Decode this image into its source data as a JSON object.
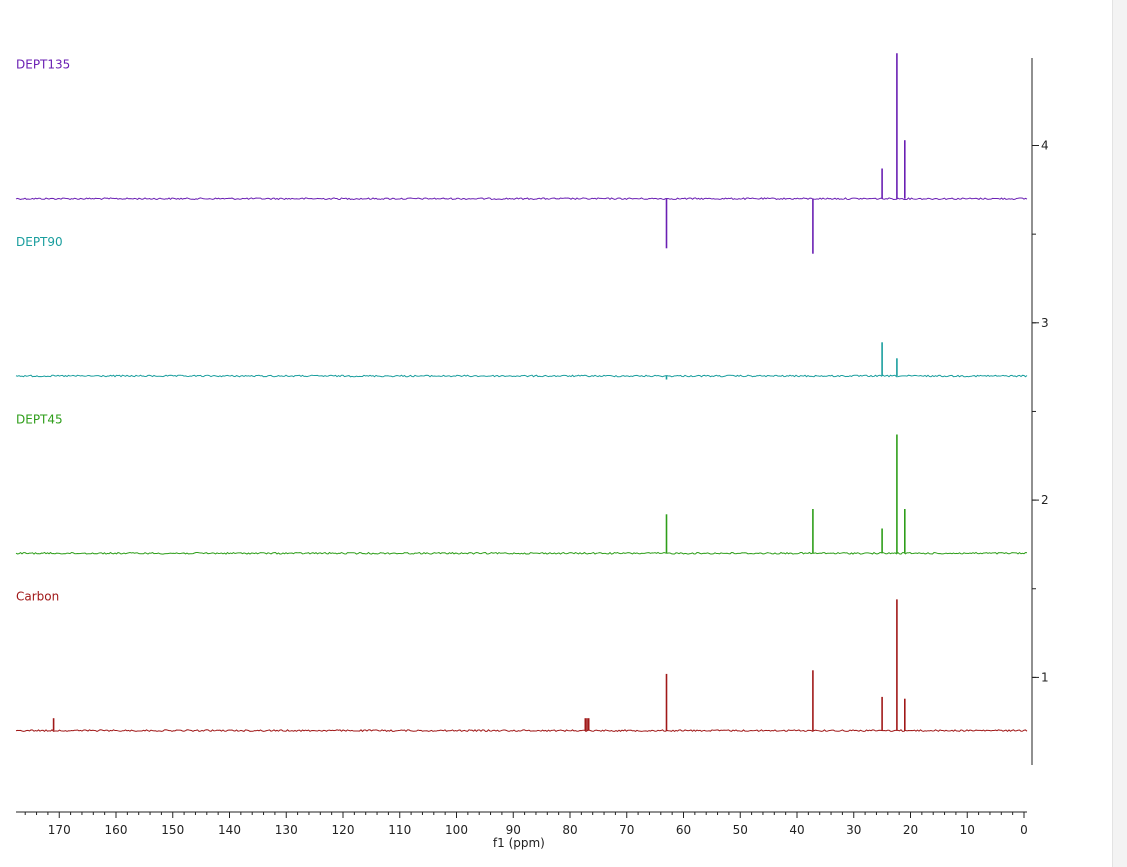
{
  "chart_data": {
    "type": "line",
    "xlabel": "f1 (ppm)",
    "xlim": [
      178,
      0
    ],
    "x_ticks": [
      170,
      160,
      150,
      140,
      130,
      120,
      110,
      100,
      90,
      80,
      70,
      60,
      50,
      40,
      30,
      20,
      10,
      0
    ],
    "ylim": [
      0.3,
      4.5
    ],
    "y_ticks": [
      1,
      2,
      3,
      4
    ],
    "series": [
      {
        "name": "DEPT135",
        "color": "#6a1fb3",
        "baseline": 3.7,
        "peaks": [
          {
            "x": 63.0,
            "y": 3.42
          },
          {
            "x": 37.2,
            "y": 3.39
          },
          {
            "x": 25.0,
            "y": 3.87
          },
          {
            "x": 22.4,
            "y": 4.52
          },
          {
            "x": 21.0,
            "y": 4.03
          }
        ]
      },
      {
        "name": "DEPT90",
        "color": "#1a9e9e",
        "baseline": 2.7,
        "peaks": [
          {
            "x": 63.0,
            "y": 2.68
          },
          {
            "x": 25.0,
            "y": 2.89
          },
          {
            "x": 22.4,
            "y": 2.8
          }
        ]
      },
      {
        "name": "DEPT45",
        "color": "#2e9e1a",
        "baseline": 1.7,
        "peaks": [
          {
            "x": 63.0,
            "y": 1.92
          },
          {
            "x": 37.2,
            "y": 1.95
          },
          {
            "x": 25.0,
            "y": 1.84
          },
          {
            "x": 22.4,
            "y": 2.37
          },
          {
            "x": 21.0,
            "y": 1.95
          }
        ]
      },
      {
        "name": "Carbon",
        "color": "#a01818",
        "baseline": 0.7,
        "peaks": [
          {
            "x": 171.0,
            "y": 0.77
          },
          {
            "x": 77.3,
            "y": 0.77
          },
          {
            "x": 77.0,
            "y": 0.77
          },
          {
            "x": 76.7,
            "y": 0.77
          },
          {
            "x": 63.0,
            "y": 1.02
          },
          {
            "x": 37.2,
            "y": 1.04
          },
          {
            "x": 25.0,
            "y": 0.89
          },
          {
            "x": 22.4,
            "y": 1.44
          },
          {
            "x": 21.0,
            "y": 0.88
          }
        ]
      }
    ]
  }
}
